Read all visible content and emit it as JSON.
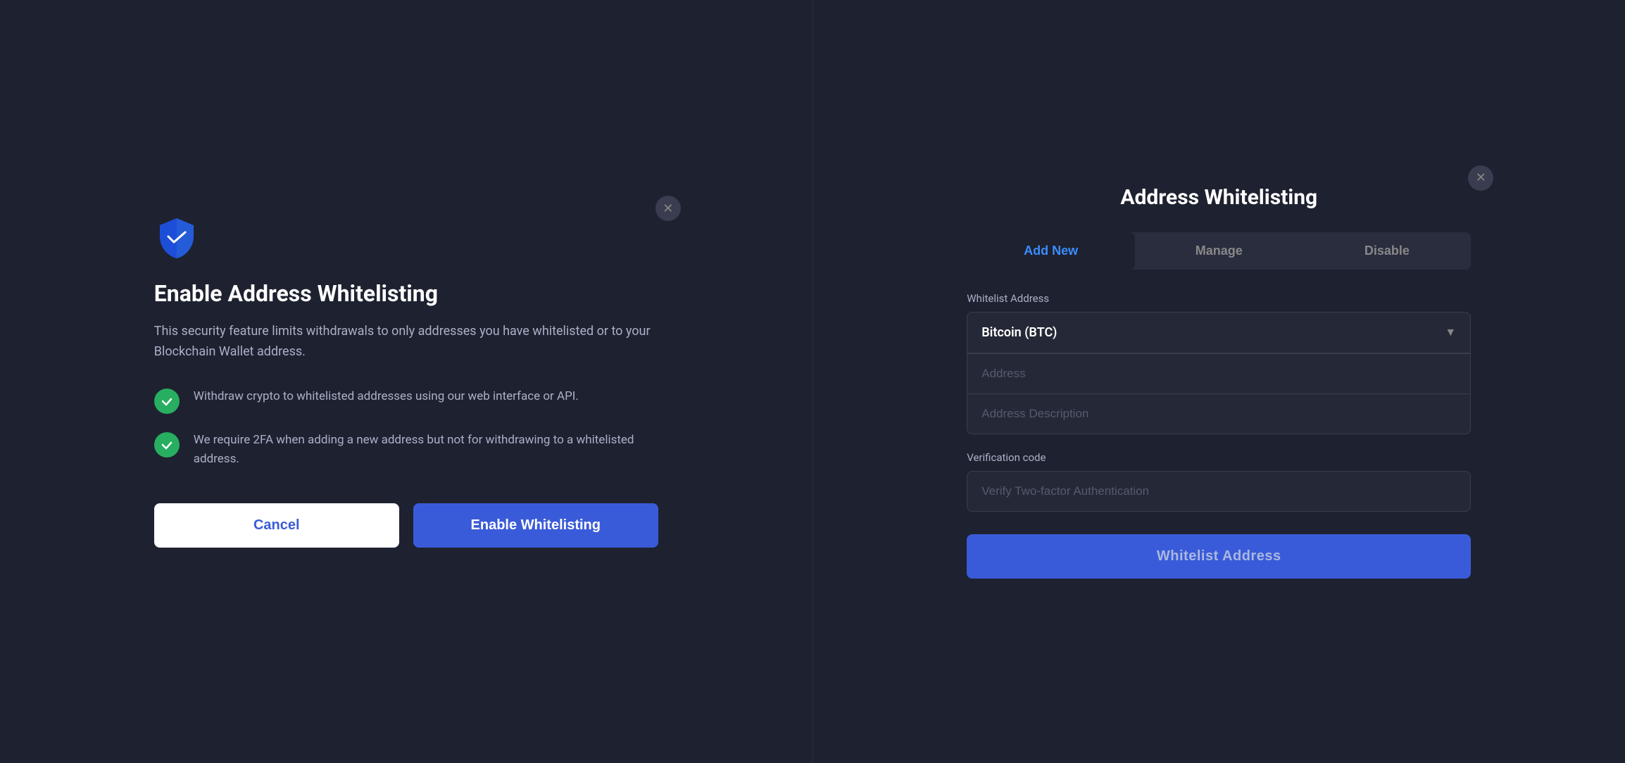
{
  "leftDialog": {
    "title": "Enable Address Whitelisting",
    "description": "This security feature limits withdrawals to only addresses you have whitelisted or to your Blockchain Wallet address.",
    "features": [
      {
        "id": "feature-1",
        "text": "Withdraw crypto to whitelisted addresses using our web interface or API."
      },
      {
        "id": "feature-2",
        "text": "We require 2FA when adding a new address but not for withdrawing to a whitelisted address."
      }
    ],
    "cancelLabel": "Cancel",
    "enableLabel": "Enable Whitelisting"
  },
  "rightDialog": {
    "title": "Address Whitelisting",
    "tabs": [
      {
        "id": "add-new",
        "label": "Add New",
        "active": true
      },
      {
        "id": "manage",
        "label": "Manage",
        "active": false
      },
      {
        "id": "disable",
        "label": "Disable",
        "active": false
      }
    ],
    "whitelistAddressLabel": "Whitelist Address",
    "selectedCurrency": "Bitcoin (BTC)",
    "addressPlaceholder": "Address",
    "addressDescriptionPlaceholder": "Address Description",
    "verificationLabel": "Verification code",
    "verificationPlaceholder": "Verify Two-factor Authentication",
    "submitLabel": "Whitelist Address"
  },
  "icons": {
    "close": "✕",
    "checkmark": "✓",
    "dropdownArrow": "▼"
  }
}
